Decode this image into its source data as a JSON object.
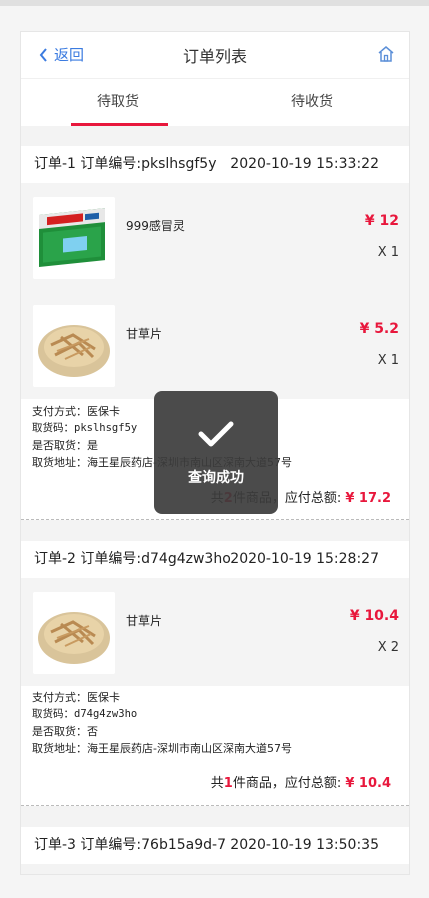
{
  "nav": {
    "back_label": "返回",
    "title": "订单列表"
  },
  "tabs": [
    {
      "label": "待取货"
    },
    {
      "label": "待收货"
    }
  ],
  "orders": [
    {
      "header": "订单-1 订单编号:pkslhsgf5y",
      "time": "2020-10-19 15:33:22",
      "items": [
        {
          "name": "999感冒灵",
          "price": "¥ 12",
          "qty": "X 1"
        },
        {
          "name": "甘草片",
          "price": "¥ 5.2",
          "qty": "X 1"
        }
      ],
      "details": [
        "支付方式：医保卡",
        "取货码：pkslhsgf5y",
        "是否取货：是",
        "取货地址：海王星辰药店-深圳市南山区深南大道57号"
      ],
      "total": {
        "prefix": "共",
        "count": "2",
        "suffix": "件商品，应付总额: ",
        "amount": "¥ 17.2"
      }
    },
    {
      "header": "订单-2 订单编号:d74g4zw3ho",
      "time": "2020-10-19 15:28:27",
      "items": [
        {
          "name": "甘草片",
          "price": "¥ 10.4",
          "qty": "X 2"
        }
      ],
      "details": [
        "支付方式：医保卡",
        "取货码：d74g4zw3ho",
        "是否取货：否",
        "取货地址：海王星辰药店-深圳市南山区深南大道57号"
      ],
      "total": {
        "prefix": "共",
        "count": "1",
        "suffix": "件商品，应付总额: ",
        "amount": "¥ 10.4"
      }
    },
    {
      "header": "订单-3 订单编号:76b15a9d-7",
      "time": "2020-10-19 13:50:35"
    }
  ],
  "toast": {
    "message": "查询成功",
    "icon": "checkmark-icon"
  },
  "colors": {
    "accent": "#e8173c",
    "link": "#3b7be0"
  }
}
